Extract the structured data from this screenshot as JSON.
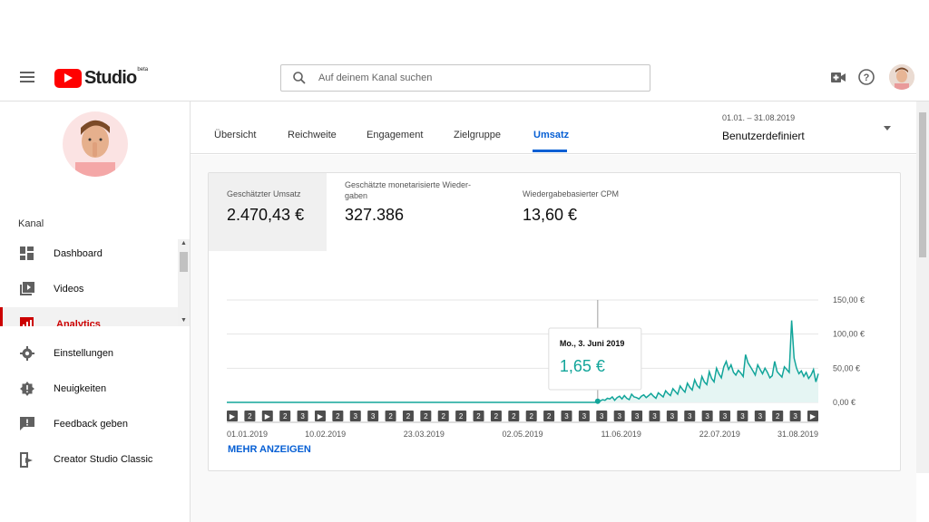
{
  "header": {
    "logo_text": "Studio",
    "logo_badge": "beta",
    "search_placeholder": "Auf deinem Kanal suchen"
  },
  "sidebar": {
    "section_label": "Kanal",
    "items": [
      {
        "label": "Dashboard",
        "icon": "dashboard-icon"
      },
      {
        "label": "Videos",
        "icon": "videos-icon"
      },
      {
        "label": "Analytics",
        "icon": "analytics-icon",
        "active": true
      },
      {
        "label": "Einstellungen",
        "icon": "gear-icon"
      },
      {
        "label": "Neuigkeiten",
        "icon": "whats-new-icon"
      },
      {
        "label": "Feedback geben",
        "icon": "feedback-icon"
      },
      {
        "label": "Creator Studio Classic",
        "icon": "classic-icon"
      }
    ]
  },
  "tabs": [
    "Übersicht",
    "Reichweite",
    "Engagement",
    "Zielgruppe",
    "Umsatz"
  ],
  "active_tab": "Umsatz",
  "date_range": {
    "range": "01.01. – 31.08.2019",
    "label": "Benutzerdefiniert"
  },
  "metrics": [
    {
      "title": "Geschätzter Umsatz",
      "value": "2.470,43 €",
      "selected": true
    },
    {
      "title_line1": "Geschätzte monetarisierte Wieder-",
      "title_line2": "gaben",
      "value": "327.386"
    },
    {
      "title": "Wiedergabebasierter CPM",
      "value": "13,60 €"
    }
  ],
  "tooltip": {
    "date": "Mo., 3. Juni 2019",
    "value": "1,65 €"
  },
  "more_button": "MEHR ANZEIGEN",
  "colors": {
    "accent": "#065fd4",
    "line": "#12a59a",
    "fill": "#e5f5f3",
    "brand": "#ff0000",
    "active_nav": "#cc0000"
  },
  "chart_data": {
    "type": "area",
    "series": [
      {
        "values": [
          0,
          0,
          0,
          0,
          0,
          0,
          0,
          0,
          0,
          0,
          0,
          0,
          0,
          0,
          0,
          0,
          0,
          0,
          0,
          0,
          0,
          0,
          0,
          0,
          0,
          0,
          0,
          0,
          0,
          0,
          0,
          0,
          0,
          0,
          0,
          0,
          0,
          0,
          0,
          0,
          0,
          0,
          0,
          0,
          0,
          0,
          0,
          0,
          0,
          0,
          0,
          0,
          0,
          0,
          0,
          0,
          0,
          0,
          0,
          0,
          0,
          0,
          0,
          0,
          0,
          0,
          0,
          0,
          0,
          0,
          0,
          0,
          0,
          0,
          0,
          0,
          0,
          0,
          0,
          0,
          0,
          0,
          0,
          0,
          0,
          0,
          0,
          0,
          0,
          0,
          0,
          0,
          0,
          0,
          0,
          0,
          0,
          0,
          0,
          0,
          0,
          0,
          0,
          0,
          0,
          0,
          0,
          0,
          0,
          0,
          0,
          0,
          0,
          0,
          0,
          0,
          0,
          0,
          0,
          0,
          0,
          0,
          0,
          0,
          0,
          0,
          0,
          0,
          0,
          0,
          0,
          0,
          0,
          0,
          0,
          0,
          0,
          0,
          0,
          0,
          0,
          0,
          0,
          0,
          0,
          0,
          0,
          0,
          0,
          0,
          0,
          0,
          0,
          1.65,
          2,
          4,
          3,
          6,
          5,
          8,
          3,
          7,
          9,
          5,
          10,
          6,
          4,
          12,
          8,
          7,
          5,
          9,
          11,
          7,
          10,
          13,
          9,
          6,
          14,
          11,
          8,
          17,
          13,
          10,
          20,
          16,
          12,
          24,
          19,
          15,
          28,
          22,
          18,
          33,
          25,
          21,
          38,
          30,
          26,
          45,
          35,
          30,
          50,
          42,
          36,
          52,
          60,
          48,
          55,
          44,
          40,
          47,
          43,
          38,
          70,
          58,
          52,
          46,
          40,
          55,
          48,
          42,
          50,
          44,
          36,
          39,
          60,
          45,
          41,
          37,
          52,
          48,
          44,
          120,
          65,
          50,
          42,
          46,
          38,
          44,
          35,
          40,
          48,
          30,
          42
        ]
      }
    ],
    "x_tick_labels": [
      "01.01.2019",
      "10.02.2019",
      "23.03.2019",
      "02.05.2019",
      "11.06.2019",
      "22.07.2019",
      "31.08.2019"
    ],
    "y_tick_labels": [
      "0,00 €",
      "50,00 €",
      "100,00 €",
      "150,00 €"
    ],
    "ylim": [
      0,
      150
    ],
    "event_markers": [
      "▶",
      "2",
      "▶",
      "2",
      "3",
      "▶",
      "2",
      "3",
      "3",
      "2",
      "2",
      "2",
      "2",
      "2",
      "2",
      "2",
      "2",
      "2",
      "2",
      "3",
      "3",
      "3",
      "3",
      "3",
      "3",
      "3",
      "3",
      "3",
      "3",
      "3",
      "3",
      "2",
      "3",
      "▶"
    ],
    "grid": true
  }
}
